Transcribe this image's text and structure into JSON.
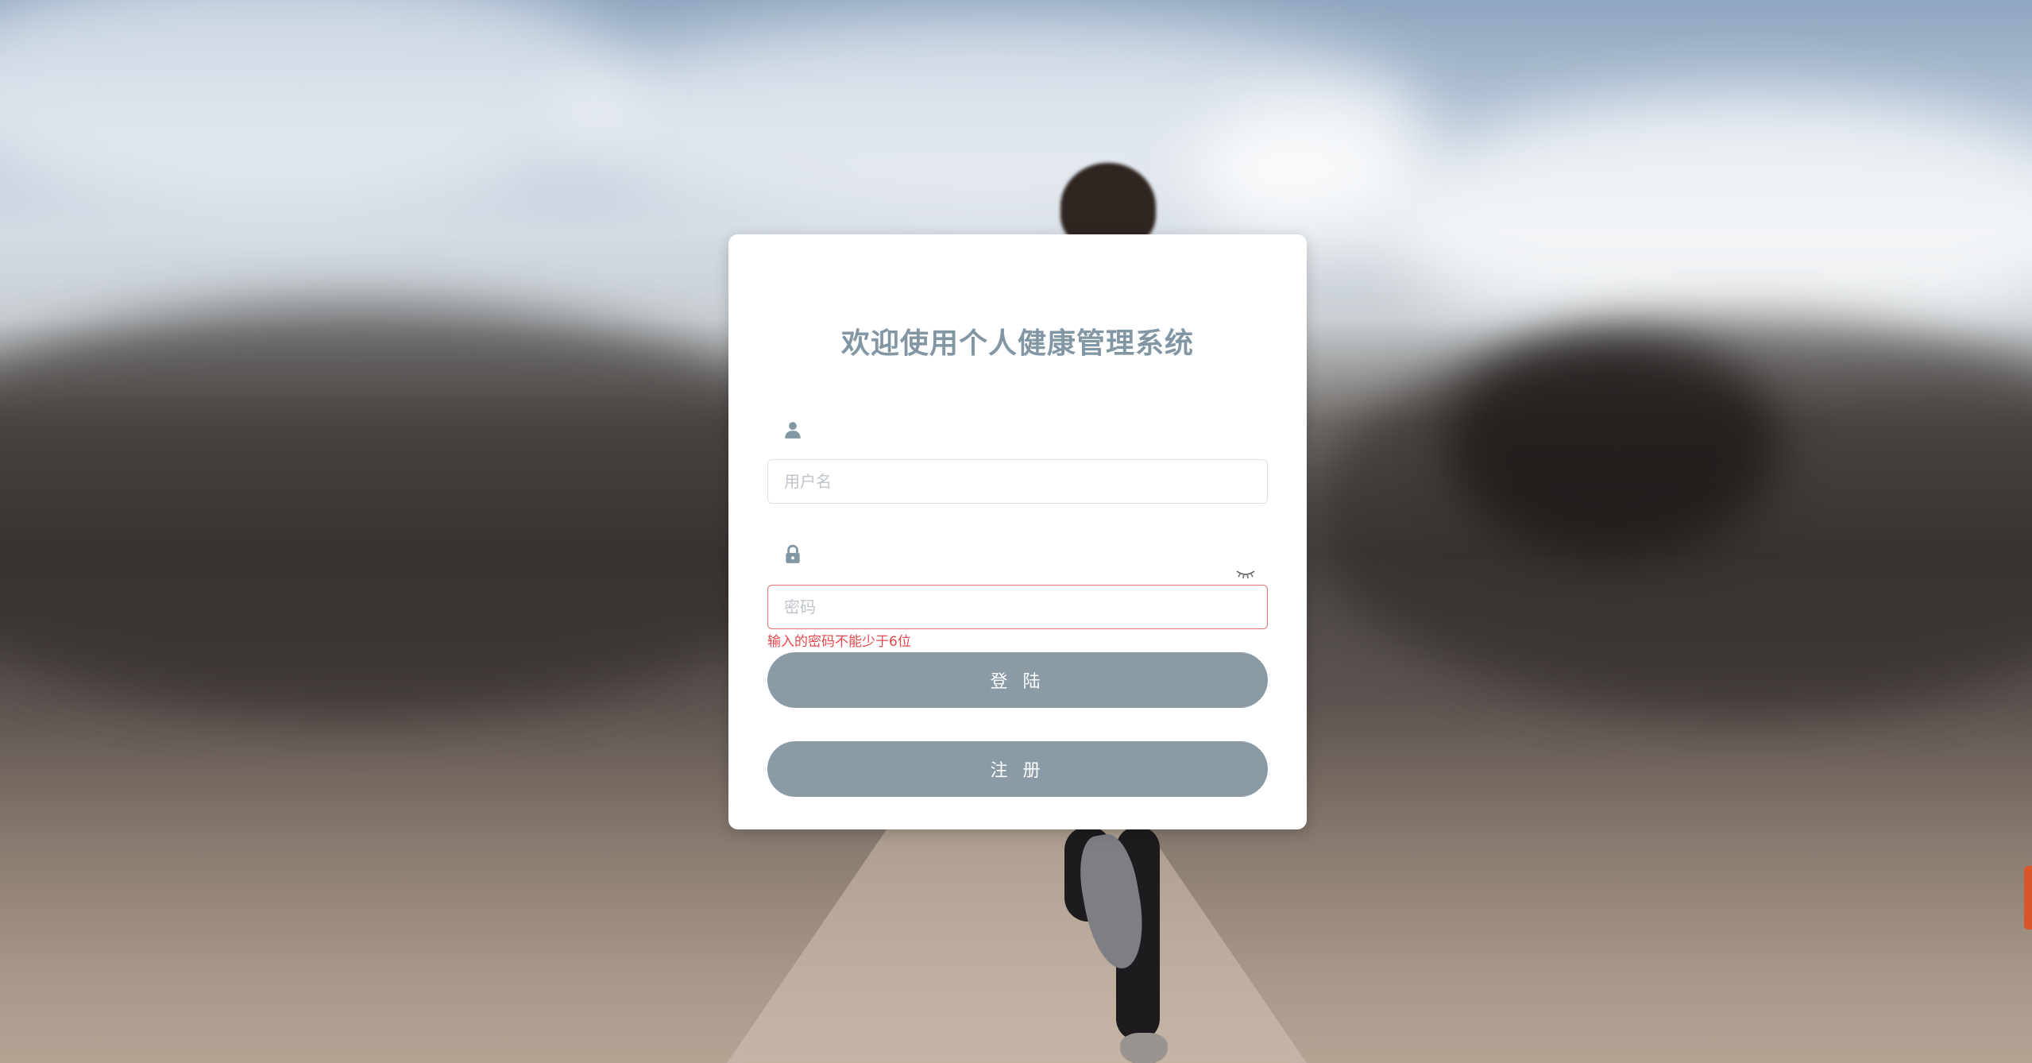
{
  "login": {
    "title": "欢迎使用个人健康管理系统",
    "username": {
      "icon": "user-icon",
      "placeholder": "用户名",
      "value": ""
    },
    "password": {
      "icon": "lock-icon",
      "toggle_icon": "eye-closed-icon",
      "placeholder": "密码",
      "value": "",
      "error": "输入的密码不能少于6位"
    },
    "login_button": "登 陆",
    "register_button": "注 册"
  },
  "colors": {
    "accent": "#8a9ba6",
    "title": "#8396a3",
    "error": "#e5484d"
  }
}
